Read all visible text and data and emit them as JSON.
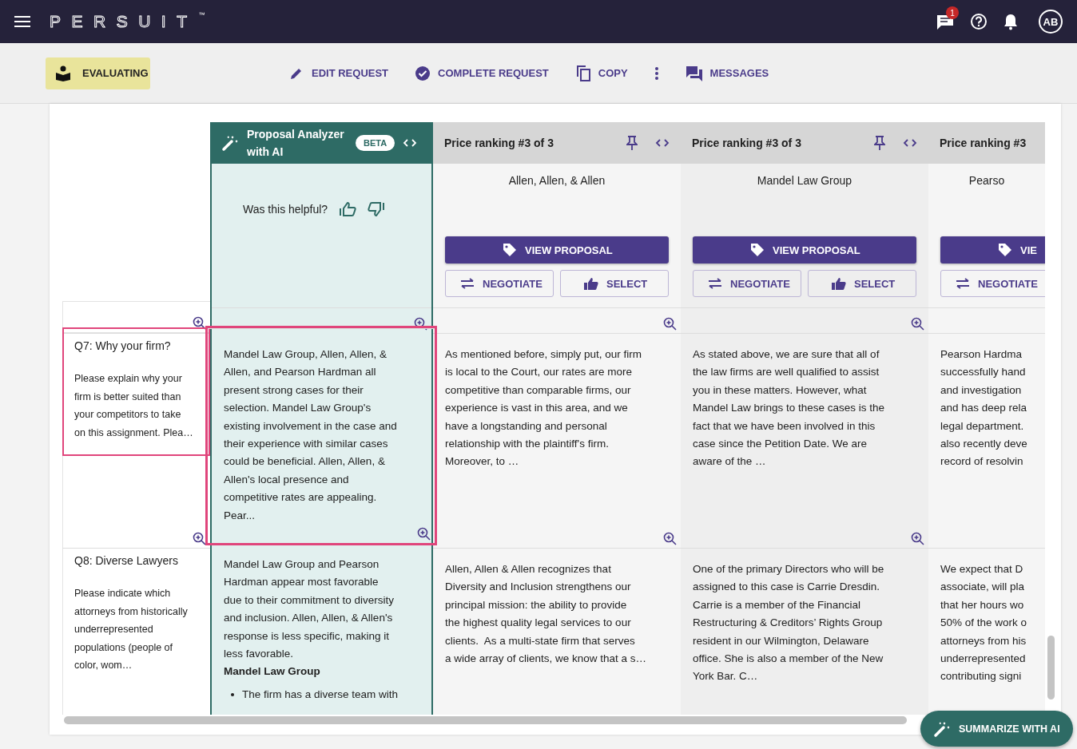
{
  "app_bar": {
    "logo": "PERSUIT",
    "logo_mark": "™",
    "notification_count": "1",
    "avatar_initials": "AB"
  },
  "toolbar": {
    "status": "EVALUATING",
    "actions": [
      {
        "kind": "edit",
        "label": "EDIT REQUEST"
      },
      {
        "kind": "complete",
        "label": "COMPLETE REQUEST"
      },
      {
        "kind": "copy",
        "label": "COPY"
      },
      {
        "kind": "more"
      },
      {
        "kind": "messages",
        "label": "MESSAGES"
      }
    ]
  },
  "ai_column": {
    "title": "Proposal Analyzer with AI",
    "badge": "BETA",
    "feedback_prompt": "Was this helpful?"
  },
  "vendors": [
    {
      "ranking": "Price ranking #3 of 3",
      "name": "Allen, Allen, & Allen",
      "view_label": "VIEW PROPOSAL",
      "negotiate_label": "NEGOTIATE",
      "select_label": "SELECT"
    },
    {
      "ranking": "Price ranking #3 of 3",
      "name": "Mandel Law Group",
      "view_label": "VIEW PROPOSAL",
      "negotiate_label": "NEGOTIATE",
      "select_label": "SELECT"
    },
    {
      "ranking": "Price ranking #3",
      "name": "Pearso",
      "view_label": "VIE",
      "negotiate_label": "NEGOTIATE"
    }
  ],
  "questions": [
    {
      "title": "Q7: Why your firm?",
      "description": "Please explain why your\nfirm is better suited than\nyour competitors to take\non this assignment. Plea…",
      "highlighted": true,
      "ai_answer": {
        "text": "Mandel Law Group, Allen, Allen, &\nAllen, and Pearson Hardman all\npresent strong cases for their\nselection. Mandel Law Group's\nexisting involvement in the case and\ntheir experience with similar cases\ncould be beneficial. Allen, Allen, &\nAllen's local presence and\ncompetitive rates are appealing.\nPear..."
      },
      "answers": [
        "As mentioned before, simply put, our firm\nis local to the Court, our rates are more\ncompetitive than comparable firms, our\nexperience is vast in this area, and we\nhave a longstanding and personal\nrelationship with the plaintiff's firm.\nMoreover, to …",
        "As stated above, we are sure that all of\nthe law firms are well qualified to assist\nyou in these matters. However, what\nMandel Law brings to these cases is the\nfact that we have been involved in this\ncase since the Petition Date. We are\naware of the …",
        "Pearson Hardma\nsuccessfully hand\nand investigation\nand has deep rela\nlegal department.\nalso recently deve\nrecord of resolvin"
      ]
    },
    {
      "title": "Q8: Diverse Lawyers",
      "description": "Please indicate which\nattorneys from historically\nunderrepresented\npopulations (people of\ncolor, wom…",
      "highlighted": false,
      "ai_answer": {
        "text": "Mandel Law Group and Pearson\nHardman appear most favorable\ndue to their commitment to diversity\nand inclusion. Allen, Allen, & Allen's\nresponse is less specific, making it\nless favorable.",
        "heading": "Mandel Law Group",
        "bullets": [
          "The firm has a diverse team with"
        ]
      },
      "answers": [
        "Allen, Allen & Allen recognizes that\nDiversity and Inclusion strengthens our\nprincipal mission: the ability to provide\nthe highest quality legal services to our\nclients.  As a multi-state firm that serves\na wide array of clients, we know that a s…",
        "One of the primary Directors who will be\nassigned to this case is Carrie Dresdin.\nCarrie is a member of the Financial\nRestructuring & Creditors’ Rights Group\nresident in our Wilmington, Delaware\noffice. She is also a member of the New\nYork Bar. C…",
        "We expect that D\nassociate, will pla\nthat her hours wo\n50% of the work o\nattorneys from his\nunderrepresented\ncontributing signi"
      ]
    }
  ],
  "summarize_button": "SUMMARIZE WITH AI"
}
